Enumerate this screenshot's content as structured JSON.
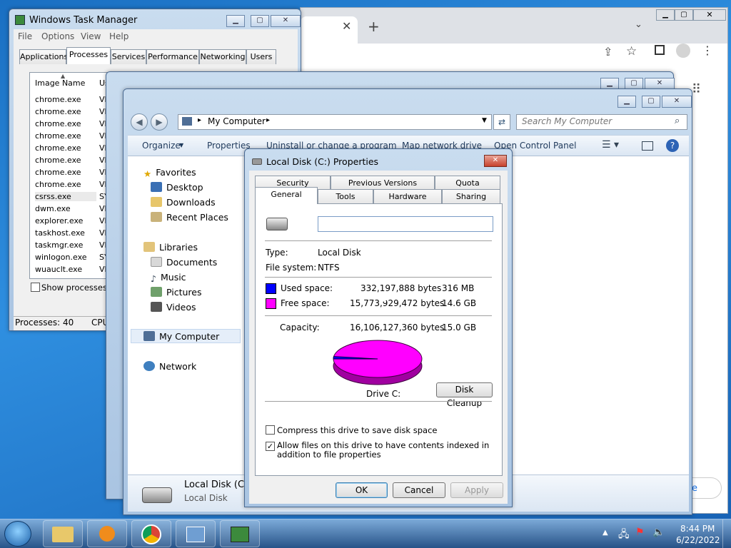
{
  "taskmgr": {
    "title": "Windows Task Manager",
    "menu": [
      "File",
      "Options",
      "View",
      "Help"
    ],
    "tabs": [
      "Applications",
      "Processes",
      "Services",
      "Performance",
      "Networking",
      "Users"
    ],
    "col_image": "Image Name",
    "col_user": "Us",
    "processes": [
      "chrome.exe",
      "chrome.exe",
      "chrome.exe",
      "chrome.exe",
      "chrome.exe",
      "chrome.exe",
      "chrome.exe",
      "chrome.exe",
      "csrss.exe",
      "dwm.exe",
      "explorer.exe",
      "taskhost.exe",
      "taskmgr.exe",
      "winlogon.exe",
      "wuauclt.exe"
    ],
    "user_marks": [
      "VI",
      "VI",
      "VI",
      "VI",
      "VI",
      "VI",
      "VI",
      "VI",
      "SY",
      "VI",
      "VI",
      "VI",
      "VI",
      "SY",
      "VI"
    ],
    "show_all": "Show processes fr",
    "status_processes": "Processes: 40",
    "status_cpu": "CPU"
  },
  "explorer": {
    "address": "My Computer",
    "search_placeholder": "Search My Computer",
    "toolbar": [
      "Organize",
      "Properties",
      "Uninstall or change a program",
      "Map network drive",
      "Open Control Panel"
    ],
    "nav": {
      "favorites": "Favorites",
      "desktop": "Desktop",
      "downloads": "Downloads",
      "recent": "Recent Places",
      "libraries": "Libraries",
      "documents": "Documents",
      "music": "Music",
      "pictures": "Pictures",
      "videos": "Videos",
      "computer": "My Computer",
      "network": "Network"
    },
    "details_name": "Local Disk (C:)",
    "details_type": "Local Disk"
  },
  "chrome": {
    "partial_text": "e"
  },
  "dialog": {
    "title": "Local Disk (C:) Properties",
    "tabs_back": [
      "Security",
      "Previous Versions",
      "Quota"
    ],
    "tabs_front": [
      "General",
      "Tools",
      "Hardware",
      "Sharing"
    ],
    "name_value": "",
    "type_label": "Type:",
    "type_value": "Local Disk",
    "fs_label": "File system:",
    "fs_value": "NTFS",
    "used_label": "Used space:",
    "used_bytes": "332,197,888 bytes",
    "used_size": "316 MB",
    "free_label": "Free space:",
    "free_bytes": "15,773,929,472 bytes",
    "free_size": "14.6 GB",
    "cap_label": "Capacity:",
    "cap_bytes": "16,106,127,360 bytes",
    "cap_size": "15.0 GB",
    "drive_label": "Drive C:",
    "cleanup": "Disk Cleanup",
    "compress": "Compress this drive to save disk space",
    "index": "Allow files on this drive to have contents indexed in addition to file properties",
    "compress_checked": false,
    "index_checked": true,
    "used_fraction": 0.0206,
    "used_color": "#0000ff",
    "free_color": "#ff00ff",
    "ok": "OK",
    "cancel": "Cancel",
    "apply": "Apply"
  },
  "taskbar": {
    "time": "8:44 PM",
    "date": "6/22/2022"
  }
}
